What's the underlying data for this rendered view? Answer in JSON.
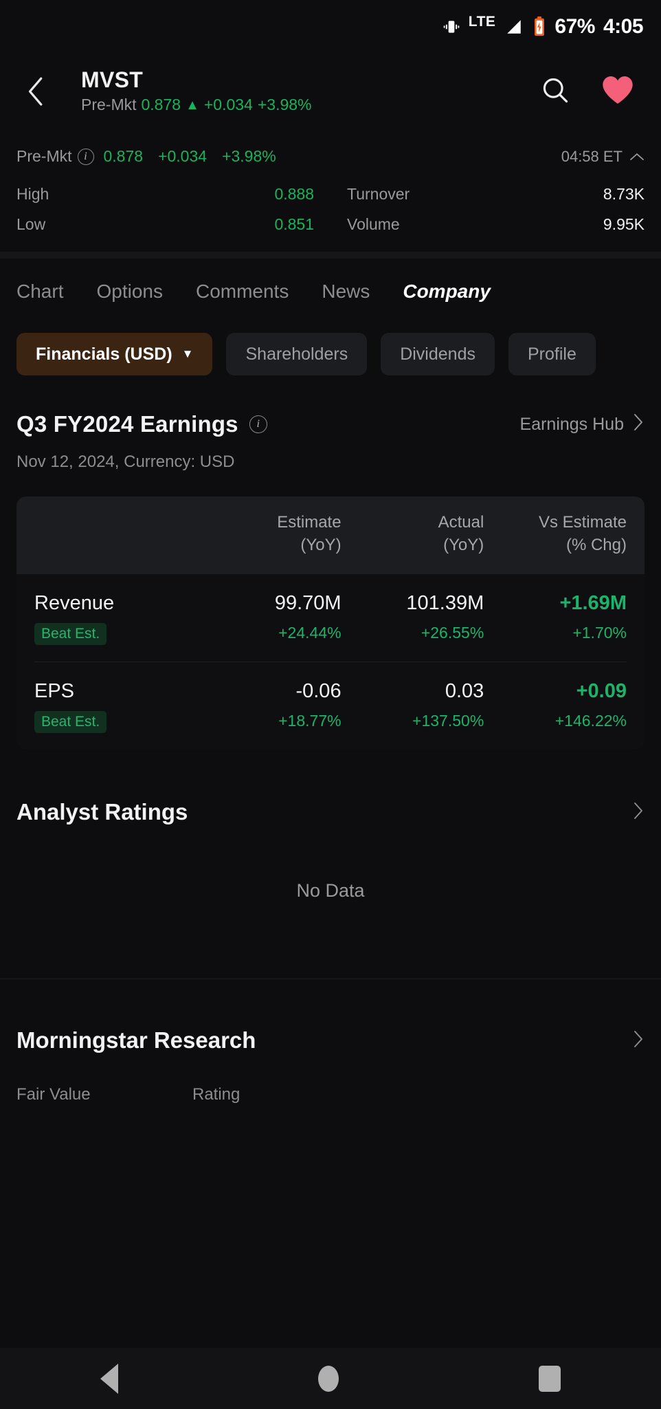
{
  "status_bar": {
    "vibrate_icon": "vibrate-icon",
    "network": "LTE",
    "signal_icon": "signal-bars-icon",
    "battery_icon": "battery-icon",
    "battery": "67%",
    "time": "4:05"
  },
  "header": {
    "back_icon": "chevron-left-icon",
    "symbol": "MVST",
    "session_label": "Pre-Mkt",
    "price": "0.878",
    "arrow": "▲",
    "change": "+0.034",
    "change_pct": "+3.98%",
    "search_icon": "search-icon",
    "favorite_icon": "heart-icon"
  },
  "quote": {
    "session_label": "Pre-Mkt",
    "info_icon": "info-icon",
    "price": "0.878",
    "change": "+0.034",
    "change_pct": "+3.98%",
    "timestamp": "04:58 ET",
    "collapse_icon": "chevron-up-icon",
    "stats": [
      {
        "label": "High",
        "value": "0.888",
        "positive": true,
        "label2": "Turnover",
        "value2": "8.73K"
      },
      {
        "label": "Low",
        "value": "0.851",
        "positive": true,
        "label2": "Volume",
        "value2": "9.95K"
      }
    ]
  },
  "tabs": [
    {
      "label": "Chart",
      "active": false
    },
    {
      "label": "Options",
      "active": false
    },
    {
      "label": "Comments",
      "active": false
    },
    {
      "label": "News",
      "active": false
    },
    {
      "label": "Company",
      "active": true
    }
  ],
  "chips": [
    {
      "label": "Financials (USD)",
      "caret": "▼",
      "active": true
    },
    {
      "label": "Shareholders",
      "active": false
    },
    {
      "label": "Dividends",
      "active": false
    },
    {
      "label": "Profile",
      "active": false
    }
  ],
  "earnings": {
    "title": "Q3 FY2024 Earnings",
    "info_icon": "info-icon",
    "hub_link": "Earnings Hub",
    "hub_chevron": "›",
    "date_line": "Nov 12, 2024, Currency: USD",
    "columns": [
      {
        "line1": "",
        "line2": ""
      },
      {
        "line1": "Estimate",
        "line2": "(YoY)"
      },
      {
        "line1": "Actual",
        "line2": "(YoY)"
      },
      {
        "line1": "Vs Estimate",
        "line2": "(% Chg)"
      }
    ],
    "rows": [
      {
        "metric": "Revenue",
        "badge": "Beat Est.",
        "estimate": "99.70M",
        "estimate_yoy": "+24.44%",
        "actual": "101.39M",
        "actual_yoy": "+26.55%",
        "vs_estimate": "+1.69M",
        "vs_estimate_pct": "+1.70%"
      },
      {
        "metric": "EPS",
        "badge": "Beat Est.",
        "estimate": "-0.06",
        "estimate_yoy": "+18.77%",
        "actual": "0.03",
        "actual_yoy": "+137.50%",
        "vs_estimate": "+0.09",
        "vs_estimate_pct": "+146.22%"
      }
    ]
  },
  "analyst_ratings": {
    "title": "Analyst Ratings",
    "chevron": "›",
    "empty_text": "No Data"
  },
  "morningstar": {
    "title": "Morningstar Research",
    "chevron": "›",
    "col1_label": "Fair Value",
    "col2_label": "Rating"
  },
  "nav_bar": {
    "back_icon": "triangle-back-icon",
    "home_icon": "circle-home-icon",
    "recents_icon": "square-recents-icon"
  },
  "colors": {
    "positive": "#19b35c",
    "accent": "#e8801a",
    "favorite": "#f4607a",
    "background": "#0d0d0f"
  }
}
